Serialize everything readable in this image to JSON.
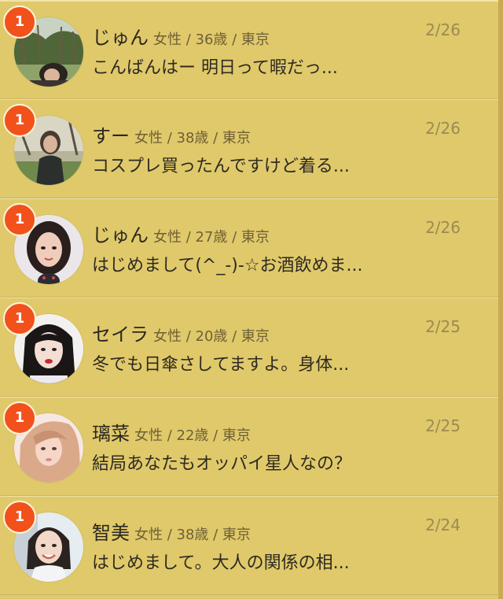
{
  "messages": [
    {
      "name": "じゅん",
      "meta": "女性 / 36歳 / 東京",
      "date": "2/26",
      "preview": "こんばんはー 明日って暇だっ...",
      "badge": "1",
      "avatar": "avatar-photo-outdoor"
    },
    {
      "name": "すー",
      "meta": "女性 / 38歳 / 東京",
      "date": "2/26",
      "preview": "コスプレ買ったんですけど着る...",
      "badge": "1",
      "avatar": "avatar-photo-park"
    },
    {
      "name": "じゅん",
      "meta": "女性 / 27歳 / 東京",
      "date": "2/26",
      "preview": "はじめまして(^_-)-☆お酒飲めま...",
      "badge": "1",
      "avatar": "avatar-photo-selfie"
    },
    {
      "name": "セイラ",
      "meta": "女性 / 20歳 / 東京",
      "date": "2/25",
      "preview": "冬でも日傘さしてますよ。身体...",
      "badge": "1",
      "avatar": "avatar-photo-portrait"
    },
    {
      "name": "璃菜",
      "meta": "女性 / 22歳 / 東京",
      "date": "2/25",
      "preview": "結局あなたもオッパイ星人なの？",
      "badge": "1",
      "avatar": "avatar-photo-blonde"
    },
    {
      "name": "智美",
      "meta": "女性 / 38歳 / 東京",
      "date": "2/24",
      "preview": "はじめまして。大人の関係の相...",
      "badge": "1",
      "avatar": "avatar-photo-smile"
    }
  ],
  "colors": {
    "background": "#e0c96a",
    "badge": "#f2511b",
    "date": "#9c8a52",
    "meta": "#6e6037"
  }
}
